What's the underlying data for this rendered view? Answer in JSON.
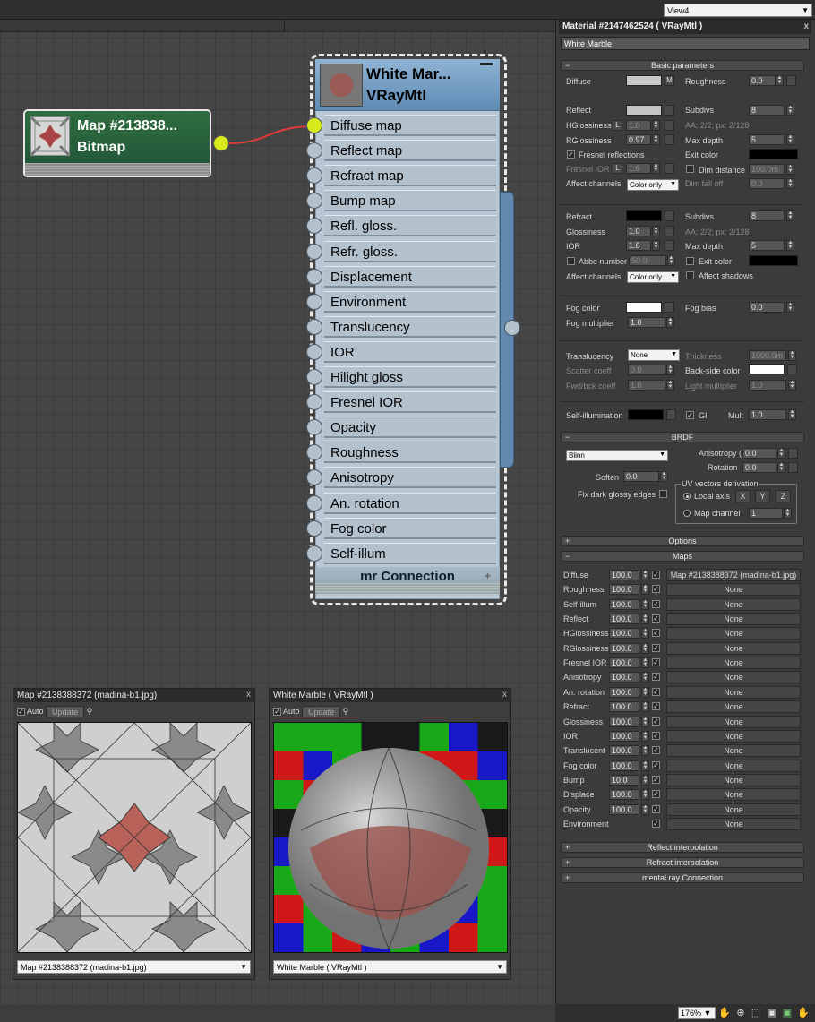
{
  "view_selector": "View4",
  "bitmap_node": {
    "title": "Map #213838...",
    "type": "Bitmap"
  },
  "material_node": {
    "title": "White Mar...",
    "type": "VRayMtl",
    "slots": [
      "Diffuse map",
      "Reflect map",
      "Refract map",
      "Bump map",
      "Refl. gloss.",
      "Refr. gloss.",
      "Displacement",
      "Environment",
      "Translucency",
      "IOR",
      "Hilight gloss",
      "Fresnel IOR",
      "Opacity",
      "Roughness",
      "Anisotropy",
      "An. rotation",
      "Fog color",
      "Self-illum"
    ],
    "footer": "mr Connection"
  },
  "preview_map": {
    "title": "Map #2138388372 (madina-b1.jpg)",
    "auto": "Auto",
    "update": "Update",
    "dropdown": "Map #2138388372 (madina-b1.jpg)"
  },
  "preview_mat": {
    "title": "White Marble  ( VRayMtl )",
    "auto": "Auto",
    "update": "Update",
    "dropdown": "White Marble  ( VRayMtl )"
  },
  "panel": {
    "title": "Material #2147462524  ( VRayMtl )",
    "name": "White Marble",
    "basic": {
      "header": "Basic parameters",
      "diffuse": "Diffuse",
      "m_button": "M",
      "roughness": "Roughness",
      "roughness_val": "0.0",
      "reflect": "Reflect",
      "subdivs": "Subdivs",
      "subdivs_val": "8",
      "hgloss": "HGlossiness",
      "l_button": "L",
      "hgloss_val": "1.0",
      "aa": "AA: 2/2; px: 2/128",
      "rgloss": "RGlossiness",
      "rgloss_val": "0.97",
      "maxdepth": "Max depth",
      "maxdepth_val": "5",
      "fresnel": "Fresnel reflections",
      "exitcolor": "Exit color",
      "fresnel_ior": "Fresnel IOR",
      "fresnel_ior_val": "1.6",
      "dimdist": "Dim distance",
      "dimdist_val": "100.0m",
      "affect": "Affect channels",
      "coloronly": "Color only",
      "dimfall": "Dim fall off",
      "dimfall_val": "0.0",
      "refract": "Refract",
      "r_subdivs_val": "8",
      "glossiness": "Glossiness",
      "gloss_val": "1.0",
      "r_aa": "AA: 2/2; px: 2/128",
      "ior": "IOR",
      "ior_val": "1.6",
      "r_maxdepth_val": "5",
      "abbe": "Abbe number",
      "abbe_val": "50.0",
      "r_exitcolor": "Exit color",
      "affect_shadows": "Affect shadows",
      "fogcolor": "Fog color",
      "fogbias": "Fog bias",
      "fogbias_val": "0.0",
      "fogmult": "Fog multiplier",
      "fogmult_val": "1.0",
      "translucency": "Translucency",
      "trans_val": "None",
      "thickness": "Thickness",
      "thickness_val": "1000.0m",
      "scatter": "Scatter coeff",
      "scatter_val": "0.0",
      "backside": "Back-side color",
      "fwdbck": "Fwd/bck coeff",
      "fwdbck_val": "1.0",
      "lightmult": "Light multiplier",
      "lightmult_val": "1.0",
      "selfillum": "Self-illumination",
      "gi": "GI",
      "mult": "Mult",
      "mult_val": "1.0"
    },
    "brdf": {
      "header": "BRDF",
      "type": "Blinn",
      "aniso": "Anisotropy (-1..1)",
      "aniso_val": "0.0",
      "rotation": "Rotation",
      "rotation_val": "0.0",
      "soften": "Soften",
      "soften_val": "0.0",
      "fixdark": "Fix dark glossy edges",
      "uvhdr": "UV vectors derivation",
      "localaxis": "Local axis",
      "x": "X",
      "y": "Y",
      "z": "Z",
      "mapchannel": "Map channel",
      "mapchannel_val": "1"
    },
    "options": "Options",
    "maps_header": "Maps",
    "maps": [
      {
        "name": "Diffuse",
        "amount": "100.0",
        "map": "Map #2138388372 (madina-b1.jpg)"
      },
      {
        "name": "Roughness",
        "amount": "100.0",
        "map": "None"
      },
      {
        "name": "Self-illum",
        "amount": "100.0",
        "map": "None"
      },
      {
        "name": "Reflect",
        "amount": "100.0",
        "map": "None"
      },
      {
        "name": "HGlossiness",
        "amount": "100.0",
        "map": "None"
      },
      {
        "name": "RGlossiness",
        "amount": "100.0",
        "map": "None"
      },
      {
        "name": "Fresnel IOR",
        "amount": "100.0",
        "map": "None"
      },
      {
        "name": "Anisotropy",
        "amount": "100.0",
        "map": "None"
      },
      {
        "name": "An. rotation",
        "amount": "100.0",
        "map": "None"
      },
      {
        "name": "Refract",
        "amount": "100.0",
        "map": "None"
      },
      {
        "name": "Glossiness",
        "amount": "100.0",
        "map": "None"
      },
      {
        "name": "IOR",
        "amount": "100.0",
        "map": "None"
      },
      {
        "name": "Translucent",
        "amount": "100.0",
        "map": "None"
      },
      {
        "name": "Fog color",
        "amount": "100.0",
        "map": "None"
      },
      {
        "name": "Bump",
        "amount": "10.0",
        "map": "None"
      },
      {
        "name": "Displace",
        "amount": "100.0",
        "map": "None"
      },
      {
        "name": "Opacity",
        "amount": "100.0",
        "map": "None"
      },
      {
        "name": "Environment",
        "amount": "",
        "map": "None"
      }
    ],
    "reflect_interp": "Reflect interpolation",
    "refract_interp": "Refract interpolation",
    "mr_connection": "mental ray Connection"
  },
  "status": {
    "zoom": "176%"
  },
  "colors": {
    "diffuse": "#c8c8c8",
    "reflect": "#c4c4c4",
    "refract": "#000000",
    "fog": "#ffffff",
    "backside": "#ffffff",
    "selfillum": "#000000",
    "node_header": "#2e6d3f",
    "mat_header": "#5e8bb5",
    "socket_active": "#d8ea1c"
  }
}
